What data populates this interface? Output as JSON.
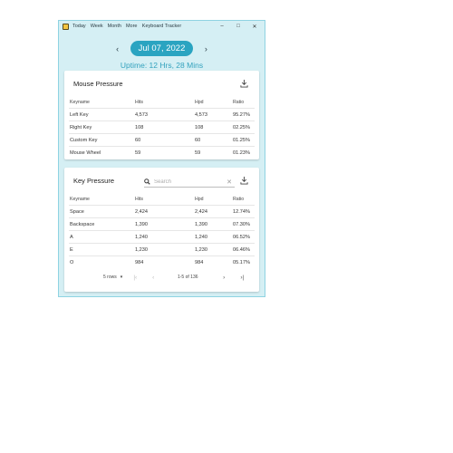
{
  "window": {
    "title": "Keyboard Tracker",
    "menu": [
      "Today",
      "Week",
      "Month",
      "More"
    ],
    "controls": {
      "minimize": "–",
      "maximize": "□",
      "close": "✕"
    }
  },
  "date_nav": {
    "prev": "‹",
    "date": "Jul 07, 2022",
    "next": "›"
  },
  "uptime": "Uptime: 12 Hrs, 28 Mins",
  "mouse_card": {
    "title": "Mouse Pressure",
    "columns": [
      "Keyname",
      "Hits",
      "Hpd",
      "Ratio"
    ],
    "rows": [
      [
        "Left Key",
        "4,573",
        "4,573",
        "95.27%"
      ],
      [
        "Right Key",
        "108",
        "108",
        "02.25%"
      ],
      [
        "Custom Key",
        "60",
        "60",
        "01.25%"
      ],
      [
        "Mouse Wheel",
        "59",
        "59",
        "01.23%"
      ]
    ]
  },
  "key_card": {
    "title": "Key Pressure",
    "search_placeholder": "Search",
    "clear": "✕",
    "columns": [
      "Keyname",
      "Hits",
      "Hpd",
      "Ratio"
    ],
    "rows": [
      [
        "Space",
        "2,424",
        "2,424",
        "12.74%"
      ],
      [
        "Backspace",
        "1,390",
        "1,390",
        "07.30%"
      ],
      [
        "A",
        "1,240",
        "1,240",
        "06.52%"
      ],
      [
        "E",
        "1,230",
        "1,230",
        "06.46%"
      ],
      [
        "O",
        "984",
        "984",
        "05.17%"
      ]
    ],
    "pagination": {
      "rows_per_page": "5 rows",
      "dropdown": "▾",
      "first": "|‹",
      "prev": "‹",
      "range": "1-5 of 136",
      "next": "›",
      "last": "›|"
    }
  },
  "colors": {
    "accent": "#2aa4c1",
    "window_bg": "#d5eff4",
    "uptime_text": "#33a2bd"
  }
}
